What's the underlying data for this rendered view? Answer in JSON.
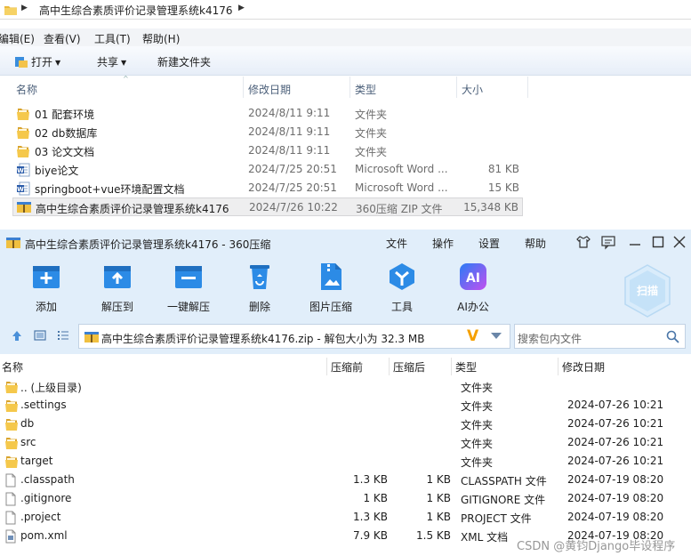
{
  "explorer": {
    "address_path": "高中生综合素质评价记录管理系统k4176",
    "menu": [
      "编辑(E)",
      "查看(V)",
      "工具(T)",
      "帮助(H)"
    ],
    "toolbar": {
      "open": "打开",
      "share": "共享",
      "new_folder": "新建文件夹"
    },
    "columns": {
      "name": "名称",
      "date": "修改日期",
      "type": "类型",
      "size": "大小"
    },
    "files": [
      {
        "name": "01 配套环境",
        "date": "2024/8/11 9:11",
        "type": "文件夹",
        "size": "",
        "icon": "folder-icon"
      },
      {
        "name": "02 db数据库",
        "date": "2024/8/11 9:11",
        "type": "文件夹",
        "size": "",
        "icon": "folder-icon"
      },
      {
        "name": "03 论文文档",
        "date": "2024/8/11 9:11",
        "type": "文件夹",
        "size": "",
        "icon": "folder-icon"
      },
      {
        "name": "biye论文",
        "date": "2024/7/25 20:51",
        "type": "Microsoft Word ...",
        "size": "81 KB",
        "icon": "word-icon"
      },
      {
        "name": "springboot+vue环境配置文档",
        "date": "2024/7/25 20:51",
        "type": "Microsoft Word ...",
        "size": "15 KB",
        "icon": "word-icon"
      },
      {
        "name": "高中生综合素质评价记录管理系统k4176",
        "date": "2024/7/26 10:22",
        "type": "360压缩 ZIP 文件",
        "size": "15,348 KB",
        "icon": "zip-icon",
        "selected": true
      }
    ]
  },
  "zip": {
    "title": "高中生综合素质评价记录管理系统k4176 - 360压缩",
    "menu": [
      "文件",
      "操作",
      "设置",
      "帮助"
    ],
    "tools": [
      {
        "label": "添加",
        "icon": "add-icon"
      },
      {
        "label": "解压到",
        "icon": "extract-to-icon"
      },
      {
        "label": "一键解压",
        "icon": "quick-extract-icon"
      },
      {
        "label": "删除",
        "icon": "delete-icon"
      },
      {
        "label": "图片压缩",
        "icon": "image-compress-icon"
      },
      {
        "label": "工具",
        "icon": "tools-icon"
      },
      {
        "label": "AI办公",
        "icon": "ai-office-icon"
      }
    ],
    "scan_label": "扫描",
    "ai_badge": "AI",
    "path_text": "高中生综合素质评价记录管理系统k4176.zip - 解包大小为 32.3 MB",
    "search_placeholder": "搜索包内文件",
    "columns": {
      "name": "名称",
      "compressed_before": "压缩前",
      "compressed_after": "压缩后",
      "type": "类型",
      "date": "修改日期"
    },
    "rows": [
      {
        "name": ".. (上级目录)",
        "before": "",
        "after": "",
        "type": "文件夹",
        "date": "",
        "icon": "folder-icon"
      },
      {
        "name": ".settings",
        "before": "",
        "after": "",
        "type": "文件夹",
        "date": "2024-07-26 10:21",
        "icon": "folder-icon"
      },
      {
        "name": "db",
        "before": "",
        "after": "",
        "type": "文件夹",
        "date": "2024-07-26 10:21",
        "icon": "folder-icon"
      },
      {
        "name": "src",
        "before": "",
        "after": "",
        "type": "文件夹",
        "date": "2024-07-26 10:21",
        "icon": "folder-icon"
      },
      {
        "name": "target",
        "before": "",
        "after": "",
        "type": "文件夹",
        "date": "2024-07-26 10:21",
        "icon": "folder-icon"
      },
      {
        "name": ".classpath",
        "before": "1.3 KB",
        "after": "1 KB",
        "type": "CLASSPATH 文件",
        "date": "2024-07-19 08:20",
        "icon": "file-icon"
      },
      {
        "name": ".gitignore",
        "before": "1 KB",
        "after": "1 KB",
        "type": "GITIGNORE 文件",
        "date": "2024-07-19 08:20",
        "icon": "file-icon"
      },
      {
        "name": ".project",
        "before": "1.3 KB",
        "after": "1 KB",
        "type": "PROJECT 文件",
        "date": "2024-07-19 08:20",
        "icon": "file-icon"
      },
      {
        "name": "pom.xml",
        "before": "7.9 KB",
        "after": "1.5 KB",
        "type": "XML 文档",
        "date": "2024-07-19 08:20",
        "icon": "xml-file-icon"
      }
    ]
  },
  "watermark": "CSDN @黄钧Django毕设程序"
}
